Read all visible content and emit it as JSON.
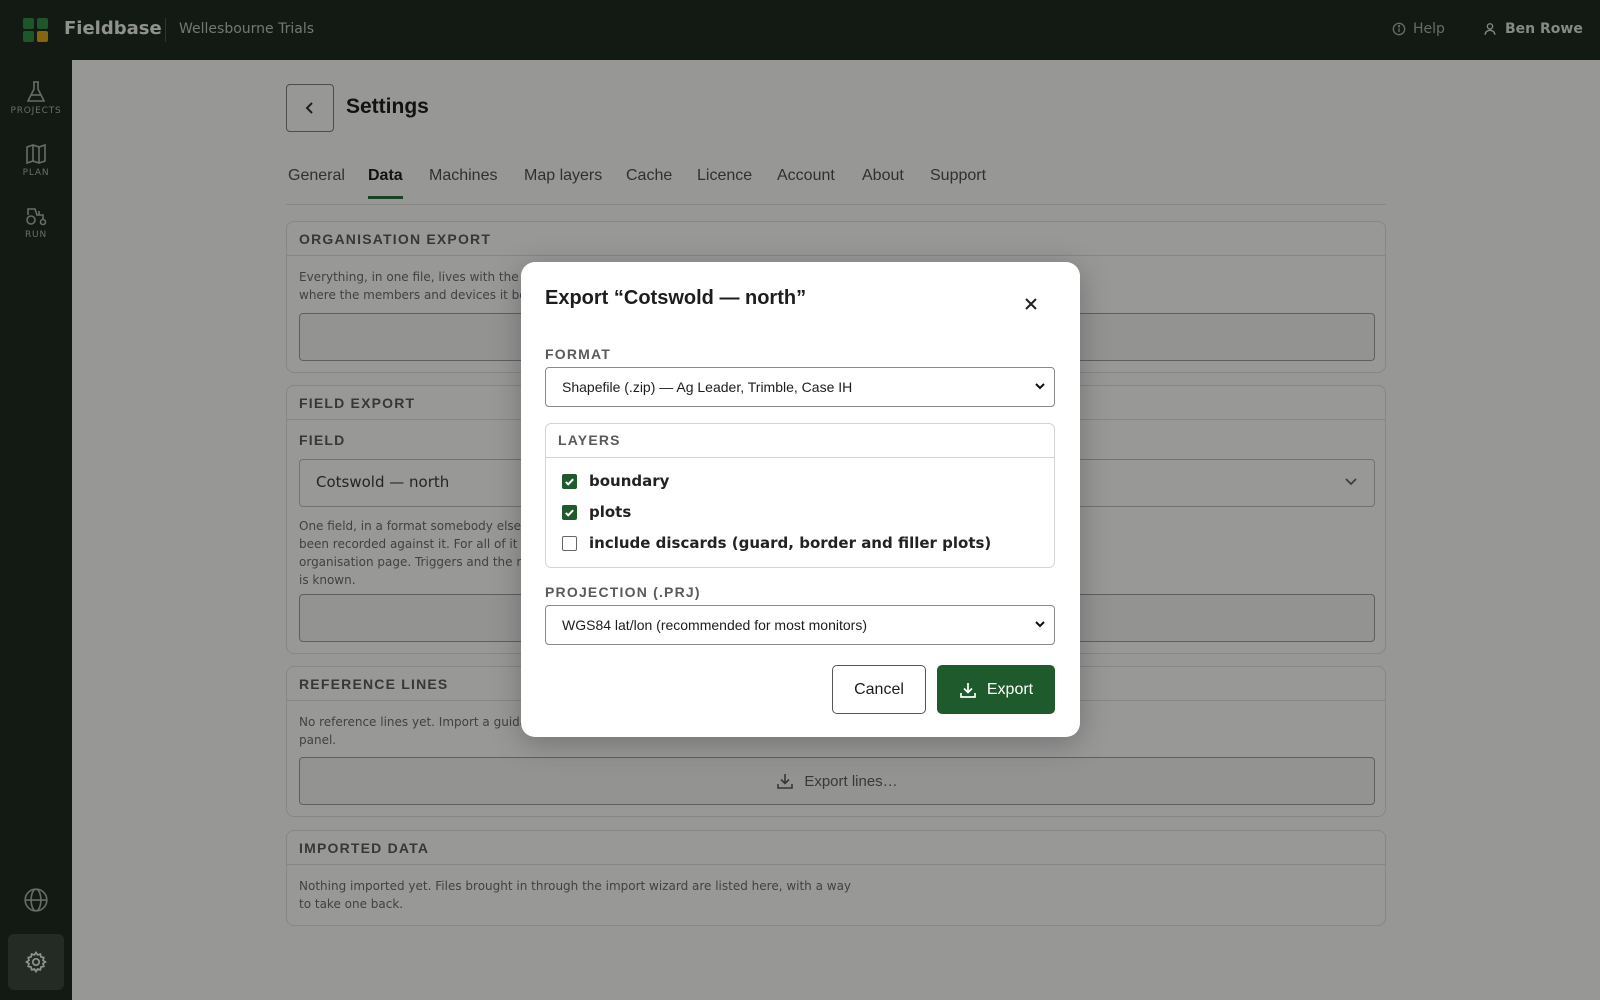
{
  "app": {
    "brand": "Fieldbase",
    "project": "Wellesbourne Trials",
    "logo_colors": [
      "#2e8b43",
      "#2e8b43",
      "#2e8b43",
      "#d9a21b"
    ]
  },
  "topbar": {
    "help_label": "Help",
    "user_name": "Ben Rowe"
  },
  "sidebar": {
    "items": [
      {
        "label": "PROJECTS",
        "icon": "flask-icon"
      },
      {
        "label": "PLAN",
        "icon": "map-icon"
      },
      {
        "label": "RUN",
        "icon": "tractor-icon"
      }
    ],
    "bottom": [
      {
        "icon": "globe-icon"
      },
      {
        "icon": "gear-icon",
        "active": true
      }
    ]
  },
  "page": {
    "title": "Settings",
    "tabs": [
      {
        "label": "General"
      },
      {
        "label": "Data",
        "active": true
      },
      {
        "label": "Machines"
      },
      {
        "label": "Map layers"
      },
      {
        "label": "Cache"
      },
      {
        "label": "Licence"
      },
      {
        "label": "Account"
      },
      {
        "label": "About"
      },
      {
        "label": "Support"
      }
    ]
  },
  "sections": {
    "org_export": {
      "heading": "ORGANISATION EXPORT",
      "text_line1": "Everything, in one file, lives with the or",
      "text_line2": "where the members and devices it bel"
    },
    "field_export": {
      "heading": "FIELD EXPORT",
      "field_label": "FIELD",
      "field_value": "Cotswold — north",
      "text_line1": "One field, in a format somebody else's",
      "text_line2": "been recorded against it. For all of it at",
      "text_line3": "organisation page. Triggers and the ma",
      "text_line4": "is known."
    },
    "reference_lines": {
      "heading": "REFERENCE LINES",
      "text_line1": "No reference lines yet. Import a guida",
      "text_line2": "panel.",
      "button_label": "Export lines…"
    },
    "imported_data": {
      "heading": "IMPORTED DATA",
      "text_line1": "Nothing imported yet. Files brought in through the import wizard are listed here, with a way",
      "text_line2": "to take one back."
    }
  },
  "modal": {
    "title": "Export “Cotswold — north”",
    "format_label": "FORMAT",
    "format_value": "Shapefile (.zip) — Ag Leader, Trimble, Case IH",
    "layers_label": "LAYERS",
    "layers": [
      {
        "label": "boundary",
        "checked": true
      },
      {
        "label": "plots",
        "checked": true
      },
      {
        "label": "include discards (guard, border and filler plots)",
        "checked": false
      }
    ],
    "projection_label": "PROJECTION (.PRJ)",
    "projection_value": "WGS84 lat/lon (recommended for most monitors)",
    "cancel_label": "Cancel",
    "export_label": "Export"
  },
  "colors": {
    "accent": "#1e5a2c",
    "chrome": "#1f2a1f"
  }
}
